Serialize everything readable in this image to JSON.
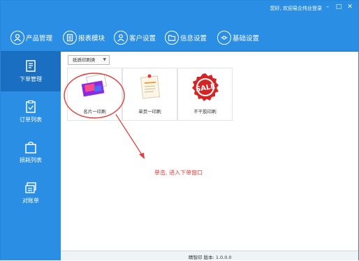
{
  "titlebar": {
    "welcome_text": "您好, 欢迎易企伟业登录",
    "minimize": "–",
    "maximize": "□",
    "close": "✕"
  },
  "toolbar": {
    "items": [
      {
        "label": "产品管理"
      },
      {
        "label": "报表模块"
      },
      {
        "label": "客户设置"
      },
      {
        "label": "信息设置"
      },
      {
        "label": "基础设置"
      }
    ]
  },
  "sidebar": {
    "items": [
      {
        "label": "下单管理",
        "active": true
      },
      {
        "label": "订单列表",
        "active": false
      },
      {
        "label": "损耗列表",
        "active": false
      },
      {
        "label": "对账单",
        "active": false
      }
    ]
  },
  "main": {
    "category_select": "纸质印刷类",
    "products": [
      {
        "label": "名片一印刷"
      },
      {
        "label": "单页一印刷"
      },
      {
        "label": "不干胶印刷"
      }
    ],
    "hint_text": "单击, 进入下单窗口"
  },
  "footer": {
    "version_text": "睛智印 版本: 1.0.0.0"
  },
  "colors": {
    "primary_blue": "#2a8ee5",
    "active_blue": "#1a6fc2",
    "annotation_red": "#e23b3b"
  }
}
